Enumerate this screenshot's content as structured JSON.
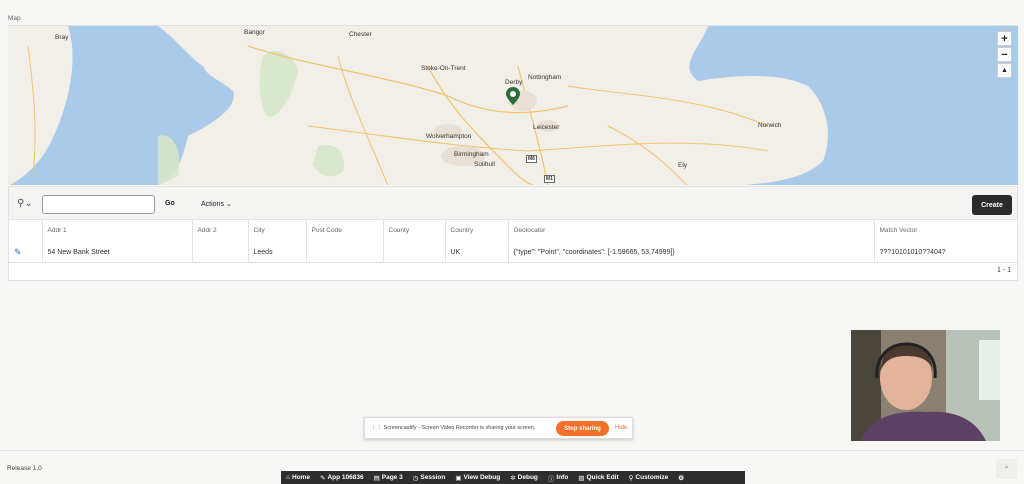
{
  "region": {
    "title": "Map"
  },
  "map": {
    "labels": [
      {
        "name": "Bray"
      },
      {
        "name": "Bangor"
      },
      {
        "name": "Chester"
      },
      {
        "name": "Stoke-On-Trent"
      },
      {
        "name": "Derby"
      },
      {
        "name": "Nottingham"
      },
      {
        "name": "Wolverhampton"
      },
      {
        "name": "Leicester"
      },
      {
        "name": "Birmingham"
      },
      {
        "name": "Solihull"
      },
      {
        "name": "Norwich"
      },
      {
        "name": "Ely"
      },
      {
        "name": "M6"
      },
      {
        "name": "M1"
      }
    ],
    "controls": {
      "zoom_in": "+",
      "zoom_out": "−",
      "reset": "▲"
    }
  },
  "report": {
    "search_placeholder": "",
    "go_label": "Go",
    "actions_label": "Actions",
    "create_label": "Create",
    "columns": [
      "",
      "Addr 1",
      "Addr 2",
      "City",
      "Post Code",
      "County",
      "Country",
      "Geolocator",
      "Match Vector"
    ],
    "rows": [
      {
        "addr1": "54 New Bank Street",
        "addr2": "",
        "city": "Leeds",
        "post_code": "",
        "county": "",
        "country": "UK",
        "geolocator": "{\"type\": \"Point\", \"coordinates\": [-1.59665, 53.74999]}",
        "match_vector": "???10101010??404?"
      }
    ],
    "pagination": "1 - 1"
  },
  "screencastify": {
    "message": "Screencastify - Screen Video Recorder is sharing your screen.",
    "stop_label": "Stop sharing",
    "hide_label": "Hide"
  },
  "footer": {
    "release": "Release 1.0",
    "scroll_top_icon": "chevron-up-icon"
  },
  "devbar": {
    "items": [
      {
        "label": "Home",
        "icon": "⌂"
      },
      {
        "label": "App 106836",
        "icon": "✎"
      },
      {
        "label": "Page 3",
        "icon": "▤"
      },
      {
        "label": "Session",
        "icon": "◷"
      },
      {
        "label": "View Debug",
        "icon": "▣"
      },
      {
        "label": "Debug",
        "icon": "✲"
      },
      {
        "label": "Info",
        "icon": "ⓘ"
      },
      {
        "label": "Quick Edit",
        "icon": "▧"
      },
      {
        "label": "Customize",
        "icon": "⚲"
      }
    ],
    "settings_icon": "gear-icon"
  },
  "colors": {
    "water": "#a9cbe9",
    "land": "#f2efe9",
    "create_btn": "#2b2b2b",
    "stop_btn": "#f36f2a",
    "marker": "#2e6b3a"
  }
}
